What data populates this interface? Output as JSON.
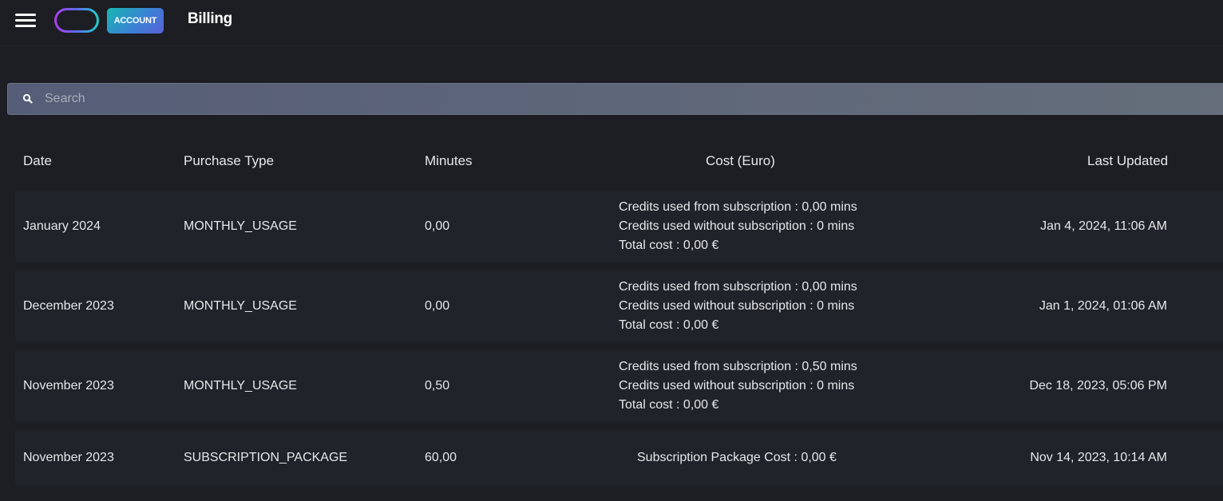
{
  "header": {
    "account_label": "ACCOUNT",
    "title": "Billing"
  },
  "search": {
    "placeholder": "Search"
  },
  "table": {
    "columns": [
      "Date",
      "Purchase Type",
      "Minutes",
      "Cost (Euro)",
      "Last Updated"
    ],
    "rows": [
      {
        "date": "January 2024",
        "type": "MONTHLY_USAGE",
        "minutes": "0,00",
        "cost": [
          "Credits used from subscription : 0,00 mins",
          "Credits used without subscription : 0 mins",
          "Total cost : 0,00 €"
        ],
        "updated": "Jan 4, 2024, 11:06 AM"
      },
      {
        "date": "December 2023",
        "type": "MONTHLY_USAGE",
        "minutes": "0,00",
        "cost": [
          "Credits used from subscription : 0,00 mins",
          "Credits used without subscription : 0 mins",
          "Total cost : 0,00 €"
        ],
        "updated": "Jan 1, 2024, 01:06 AM"
      },
      {
        "date": "November 2023",
        "type": "MONTHLY_USAGE",
        "minutes": "0,50",
        "cost": [
          "Credits used from subscription : 0,50 mins",
          "Credits used without subscription : 0 mins",
          "Total cost : 0,00 €"
        ],
        "updated": "Dec 18, 2023, 05:06 PM"
      },
      {
        "date": "November 2023",
        "type": "SUBSCRIPTION_PACKAGE",
        "minutes": "60,00",
        "cost": [
          "Subscription Package Cost : 0,00 €"
        ],
        "updated": "Nov 14, 2023, 10:14 AM"
      }
    ]
  },
  "icons": {
    "menu": "hamburger-menu-icon",
    "logo": "logo-ring-icon",
    "search": "search-icon"
  },
  "colors": {
    "background": "#1c1e24",
    "row_background": "#20232a",
    "search_bar": "#5e6679",
    "accent_gradient_start": "#17b6b2",
    "accent_gradient_end": "#5a62d8"
  }
}
